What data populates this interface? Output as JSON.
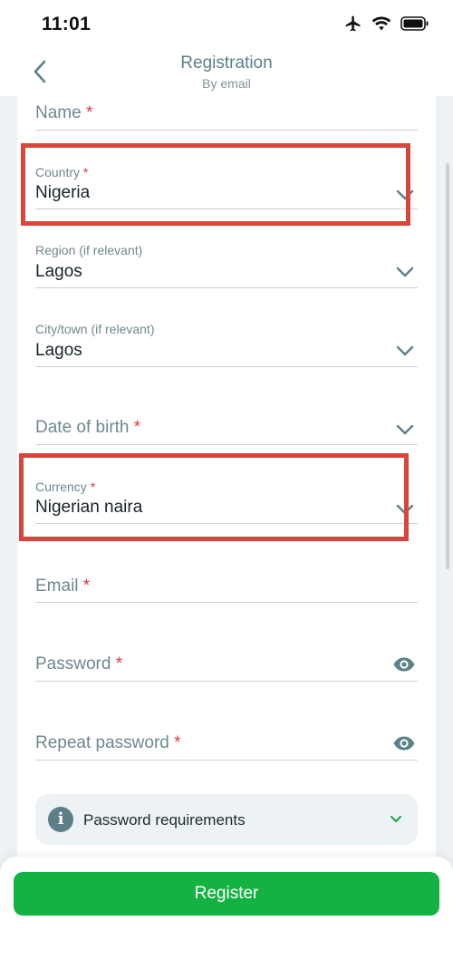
{
  "status_bar": {
    "time": "11:01",
    "icons": [
      "airplane-icon",
      "wifi-icon",
      "battery-icon"
    ]
  },
  "nav": {
    "title": "Registration",
    "subtitle": "By email",
    "back_icon": "chevron-left-icon"
  },
  "form": {
    "name": {
      "placeholder": "Name",
      "required_mark": "*"
    },
    "country": {
      "label": "Country",
      "required_mark": "*",
      "value": "Nigeria"
    },
    "region": {
      "label": "Region (if relevant)",
      "value": "Lagos"
    },
    "city": {
      "label": "City/town (if relevant)",
      "value": "Lagos"
    },
    "dob": {
      "placeholder": "Date of birth",
      "required_mark": "*"
    },
    "currency": {
      "label": "Currency",
      "required_mark": "*",
      "value": "Nigerian naira"
    },
    "email": {
      "placeholder": "Email",
      "required_mark": "*"
    },
    "password": {
      "placeholder": "Password",
      "required_mark": "*"
    },
    "repeat_password": {
      "placeholder": "Repeat password",
      "required_mark": "*"
    },
    "password_requirements": {
      "label": "Password requirements",
      "icon": "info-icon"
    }
  },
  "actions": {
    "register_label": "Register"
  },
  "colors": {
    "accent_text": "#5b8189",
    "required": "#e0393e",
    "button": "#14b243",
    "highlight_box": "#d9453b",
    "background": "#edf2f4"
  }
}
